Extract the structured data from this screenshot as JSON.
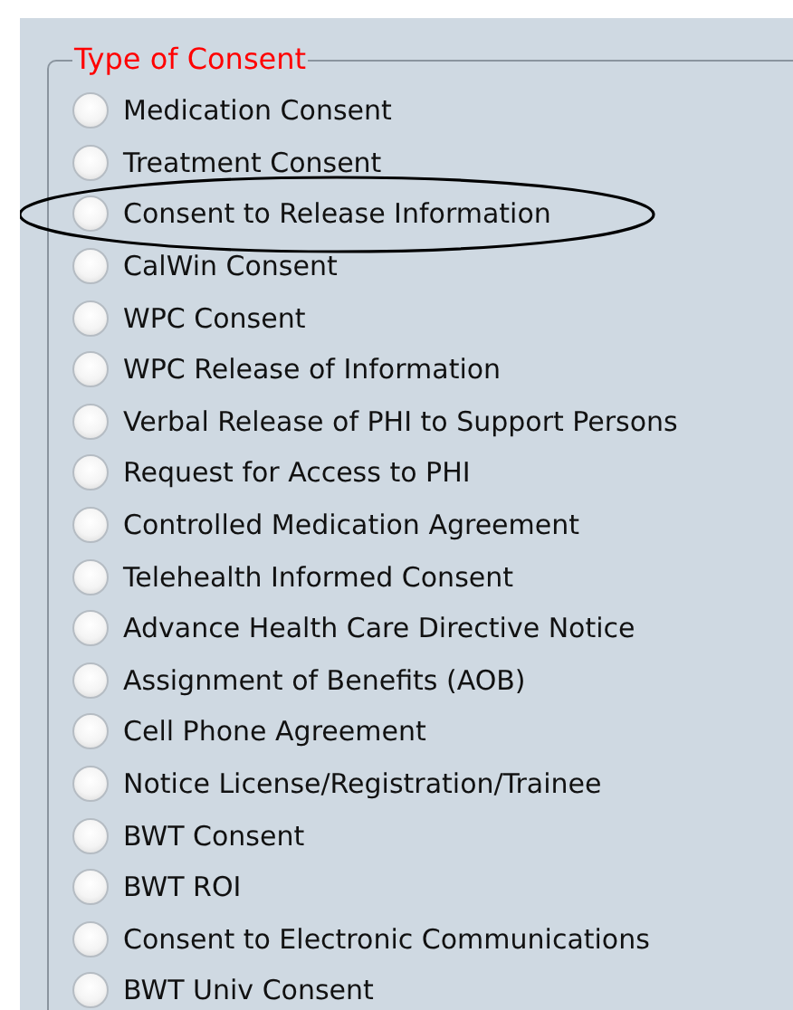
{
  "group": {
    "legend": "Type of Consent",
    "options": [
      {
        "label": "Medication Consent",
        "selected": false,
        "circled": false
      },
      {
        "label": "Treatment Consent",
        "selected": false,
        "circled": false
      },
      {
        "label": "Consent to Release Information",
        "selected": false,
        "circled": true
      },
      {
        "label": "CalWin Consent",
        "selected": false,
        "circled": false
      },
      {
        "label": "WPC Consent",
        "selected": false,
        "circled": false
      },
      {
        "label": "WPC Release of Information",
        "selected": false,
        "circled": false
      },
      {
        "label": "Verbal Release of PHI to Support Persons",
        "selected": false,
        "circled": false
      },
      {
        "label": "Request for Access to PHI",
        "selected": false,
        "circled": false
      },
      {
        "label": "Controlled Medication Agreement",
        "selected": false,
        "circled": false
      },
      {
        "label": "Telehealth Informed Consent",
        "selected": false,
        "circled": false
      },
      {
        "label": "Advance Health Care Directive Notice",
        "selected": false,
        "circled": false
      },
      {
        "label": "Assignment of Benefits (AOB)",
        "selected": false,
        "circled": false
      },
      {
        "label": "Cell Phone Agreement",
        "selected": false,
        "circled": false
      },
      {
        "label": "Notice License/Registration/Trainee",
        "selected": false,
        "circled": false
      },
      {
        "label": "BWT Consent",
        "selected": false,
        "circled": false
      },
      {
        "label": "BWT ROI",
        "selected": false,
        "circled": false
      },
      {
        "label": "Consent to Electronic Communications",
        "selected": false,
        "circled": false
      },
      {
        "label": "BWT Univ Consent",
        "selected": false,
        "circled": false
      }
    ]
  }
}
